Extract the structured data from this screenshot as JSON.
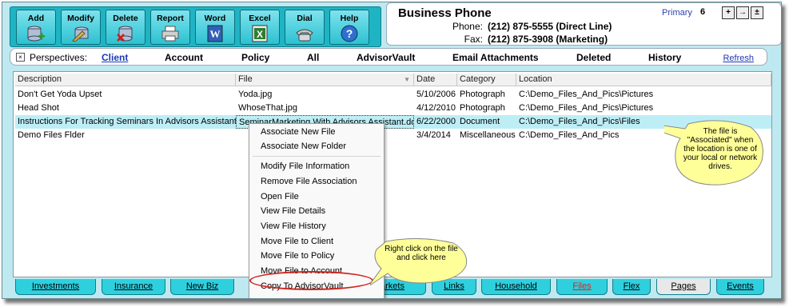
{
  "toolbar": {
    "buttons": [
      {
        "label": "Add",
        "icon": "add-database-icon"
      },
      {
        "label": "Modify",
        "icon": "modify-pencil-icon"
      },
      {
        "label": "Delete",
        "icon": "delete-database-icon"
      },
      {
        "label": "Report",
        "icon": "printer-icon"
      },
      {
        "label": "Word",
        "icon": "word-icon"
      },
      {
        "label": "Excel",
        "icon": "excel-icon"
      },
      {
        "label": "Dial",
        "icon": "telephone-icon"
      },
      {
        "label": "Help",
        "icon": "help-icon"
      }
    ]
  },
  "phone_panel": {
    "title": "Business Phone",
    "phone_label": "Phone:",
    "phone_value": "(212) 875-5555  (Direct Line)",
    "fax_label": "Fax:",
    "fax_value": "(212) 875-3908  (Marketing)",
    "primary": "Primary",
    "count": "6",
    "controls": [
      "+",
      "→",
      "±"
    ]
  },
  "perspectives": {
    "label": "Perspectives:",
    "tabs": [
      "Client",
      "Account",
      "Policy",
      "All",
      "AdvisorVault",
      "Email Attachments",
      "Deleted",
      "History"
    ],
    "active": "Client",
    "refresh": "Refresh"
  },
  "grid": {
    "columns": [
      "Description",
      "File",
      "Date",
      "Category",
      "Location"
    ],
    "rows": [
      {
        "description": "Don't Get Yoda Upset",
        "file": "Yoda.jpg",
        "date": "5/10/2006",
        "category": "Photograph",
        "location": "C:\\Demo_Files_And_Pics\\Pictures"
      },
      {
        "description": "Head Shot",
        "file": "WhoseThat.jpg",
        "date": "4/12/2010",
        "category": "Photograph",
        "location": "C:\\Demo_Files_And_Pics\\Pictures"
      },
      {
        "description": "Instructions For Tracking Seminars In Advisors Assistant",
        "file": "SeminarMarketing With Advisors Assistant.doc",
        "date": "6/22/2000",
        "category": "Document",
        "location": "C:\\Demo_Files_And_Pics\\Files"
      },
      {
        "description": "Demo Files Flder",
        "file": "",
        "date": "3/4/2014",
        "category": "Miscellaneous",
        "location": "C:\\Demo_Files_And_Pics"
      }
    ]
  },
  "context_menu": {
    "items": [
      "Associate New File",
      "Associate New Folder",
      "Modify File Information",
      "Remove File Association",
      "Open File",
      "View File Details",
      "View File History",
      "Move File to Client",
      "Move File to Policy",
      "Move File to Account",
      "Copy To AdvisorVault"
    ]
  },
  "callouts": {
    "location_note": "The file is \"Associated\" when the location is one of your local or network drives.",
    "right_click_note": "Right click on the file and click here"
  },
  "bottom_tabs": [
    "Investments",
    "Insurance",
    "New Biz",
    "arkets",
    "Links",
    "Household",
    "Files",
    "Flex",
    "Pages",
    "Events"
  ],
  "colors": {
    "accent": "#1fb4c4",
    "selected_row": "#bdeef6",
    "callout": "#ffff99",
    "highlight": "#d0241c",
    "active_tab_text": "#e02020"
  }
}
